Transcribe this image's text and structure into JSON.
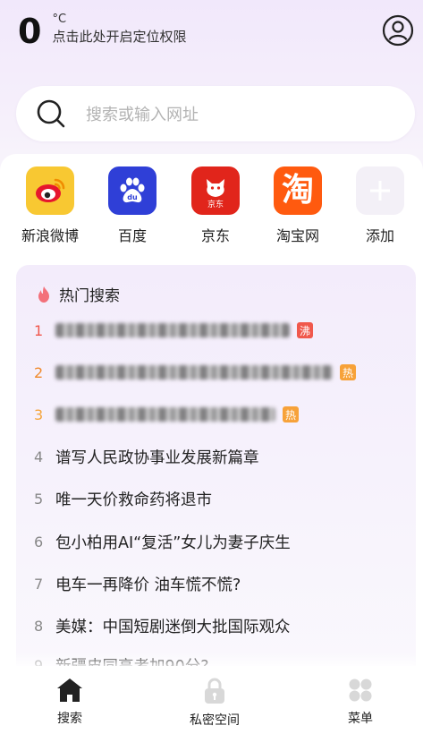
{
  "weather": {
    "temperature": "0",
    "unit": "°C",
    "location_prompt": "点击此处开启定位权限"
  },
  "search": {
    "placeholder": "搜索或输入网址"
  },
  "shortcuts": [
    {
      "label": "新浪微博",
      "icon": "weibo-icon",
      "color": "#f8c832"
    },
    {
      "label": "百度",
      "icon": "baidu-icon",
      "color": "#2f3fd7"
    },
    {
      "label": "京东",
      "icon": "jd-icon",
      "color": "#e1251b"
    },
    {
      "label": "淘宝网",
      "icon": "taobao-icon",
      "color": "#ff5a0f",
      "glyph": "淘"
    },
    {
      "label": "添加",
      "icon": "add-icon",
      "color": "#f3f0f7"
    }
  ],
  "hot": {
    "title": "热门搜索",
    "items": [
      {
        "rank": "1",
        "text": "",
        "badge": "沸",
        "badge_color": "#f0584c",
        "rank_color": "#f0584c",
        "blurred": true
      },
      {
        "rank": "2",
        "text": "",
        "badge": "热",
        "badge_color": "#f7a239",
        "rank_color": "#f08a2c",
        "blurred": true
      },
      {
        "rank": "3",
        "text": "",
        "badge": "热",
        "badge_color": "#f7a239",
        "rank_color": "#f5a53c",
        "blurred": true
      },
      {
        "rank": "4",
        "text": "谱写人民政协事业发展新篇章"
      },
      {
        "rank": "5",
        "text": "唯一天价救命药将退市"
      },
      {
        "rank": "6",
        "text": "包小柏用AI“复活”女儿为妻子庆生"
      },
      {
        "rank": "7",
        "text": "电车一再降价 油车慌不慌?"
      },
      {
        "rank": "8",
        "text": "美媒：中国短剧迷倒大批国际观众"
      },
      {
        "rank": "9",
        "text": "新疆皮同高考加90分?"
      }
    ]
  },
  "tabbar": [
    {
      "label": "搜索",
      "icon": "home-icon"
    },
    {
      "label": "私密空间",
      "icon": "lock-icon"
    },
    {
      "label": "菜单",
      "icon": "menu-grid-icon"
    }
  ]
}
